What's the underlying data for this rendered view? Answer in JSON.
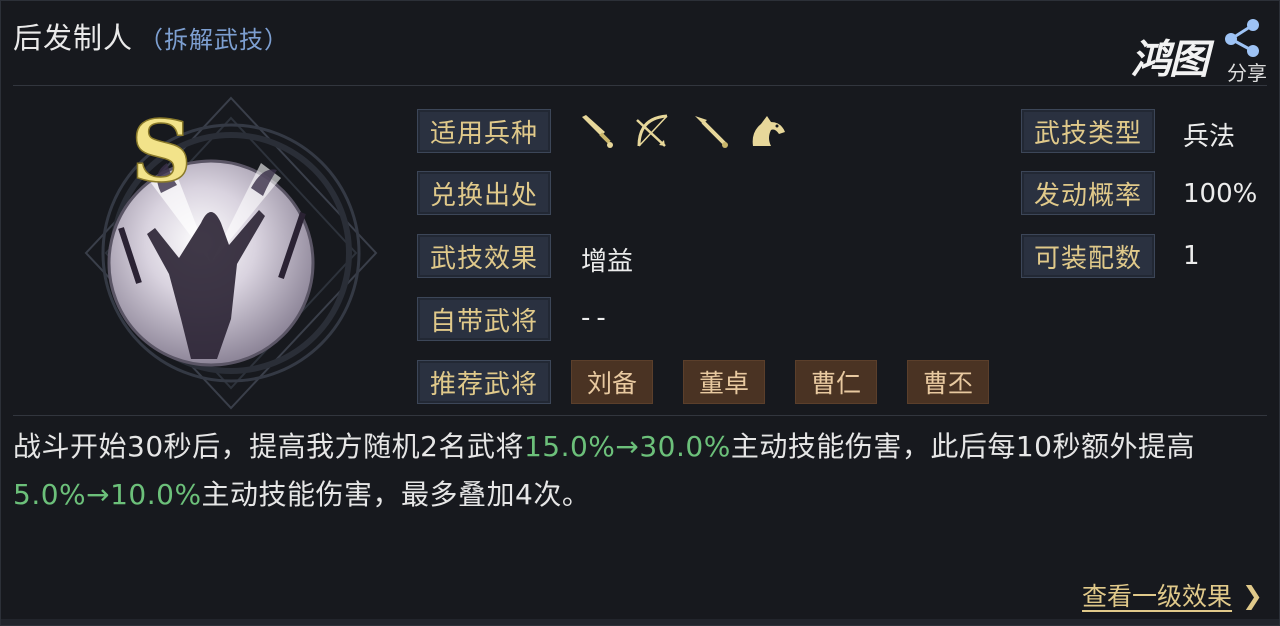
{
  "header": {
    "title": "后发制人",
    "subtitle_open": "（",
    "subtitle": "拆解武技",
    "subtitle_close": "）"
  },
  "share": {
    "logo_text": "鸿图",
    "label": "分享"
  },
  "skill": {
    "grade": "S",
    "grade_color": "#f2e38a"
  },
  "left_fields": {
    "unit_type": {
      "label": "适用兵种",
      "icons": [
        "sword-icon",
        "bow-icon",
        "spear-icon",
        "horse-icon"
      ]
    },
    "source": {
      "label": "兑换出处",
      "value": ""
    },
    "effect": {
      "label": "武技效果",
      "value": "增益"
    },
    "own_general": {
      "label": "自带武将",
      "value": "--"
    },
    "recommended": {
      "label": "推荐武将",
      "generals": [
        "刘备",
        "董卓",
        "曹仁",
        "曹丕"
      ]
    }
  },
  "right_fields": {
    "type": {
      "label": "武技类型",
      "value": "兵法"
    },
    "rate": {
      "label": "发动概率",
      "value": "100%"
    },
    "equip_count": {
      "label": "可装配数",
      "value": "1"
    }
  },
  "description": {
    "part1": "战斗开始30秒后，提高我方随机2名武将",
    "green1": "15.0%→30.0%",
    "part2": "主动技能伤害，此后每10秒额外提高",
    "green2": "5.0%→10.0%",
    "part3": "主动技能伤害，最多叠加4次。"
  },
  "footer": {
    "more_label": "查看一级效果",
    "arrow": "❯"
  },
  "colors": {
    "label_text": "#e0c98a",
    "highlight": "#6cc07a",
    "accent_blue": "#7d9fd1"
  }
}
